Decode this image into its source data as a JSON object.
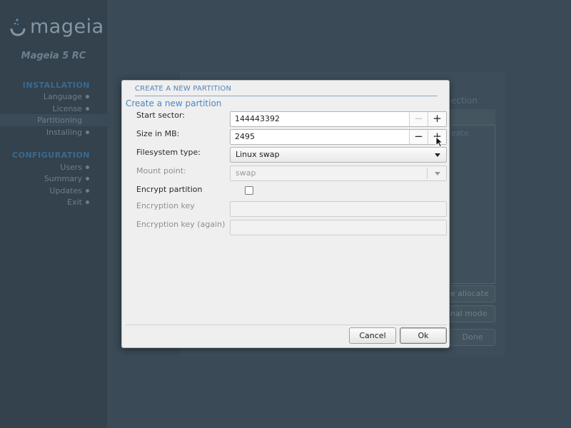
{
  "sidebar": {
    "logo_text": "mageia",
    "version": "Mageia 5 RC",
    "sections": [
      {
        "title": "INSTALLATION",
        "items": [
          {
            "label": "Language"
          },
          {
            "label": "License"
          },
          {
            "label": "Partitioning"
          },
          {
            "label": "Installing"
          }
        ]
      },
      {
        "title": "CONFIGURATION",
        "items": [
          {
            "label": "Users"
          },
          {
            "label": "Summary"
          },
          {
            "label": "Updates"
          },
          {
            "label": "Exit"
          }
        ]
      }
    ]
  },
  "background": {
    "ghost_title": "ection",
    "list_row": "eate",
    "auto_allocate": "e allocate",
    "normal_mode": "nal mode",
    "done": "Done"
  },
  "dialog": {
    "header": "CREATE A NEW PARTITION",
    "subtitle": "Create a new partition",
    "start_sector": {
      "label": "Start sector:",
      "value": "144443392",
      "minus": "−",
      "plus": "+"
    },
    "size_mb": {
      "label": "Size in MB:",
      "value": "2495",
      "minus": "−",
      "plus": "+"
    },
    "filesystem": {
      "label": "Filesystem type:",
      "value": "Linux swap"
    },
    "mount_point": {
      "label": "Mount point:",
      "value": "swap"
    },
    "encrypt": {
      "label": "Encrypt partition",
      "checked": false
    },
    "encryption_key": {
      "label": "Encryption key",
      "value": ""
    },
    "encryption_key_again": {
      "label": "Encryption key (again)",
      "value": ""
    },
    "cancel_label": "Cancel",
    "ok_label": "Ok"
  },
  "colors": {
    "sidebar_bg": "#33424d",
    "accent_blue": "#4c86c6",
    "section_title": "#3b6a8f"
  },
  "icons": {
    "logo": "mageia-logo-icon",
    "dropdown": "chevron-down-icon",
    "cursor": "mouse-pointer-icon"
  }
}
